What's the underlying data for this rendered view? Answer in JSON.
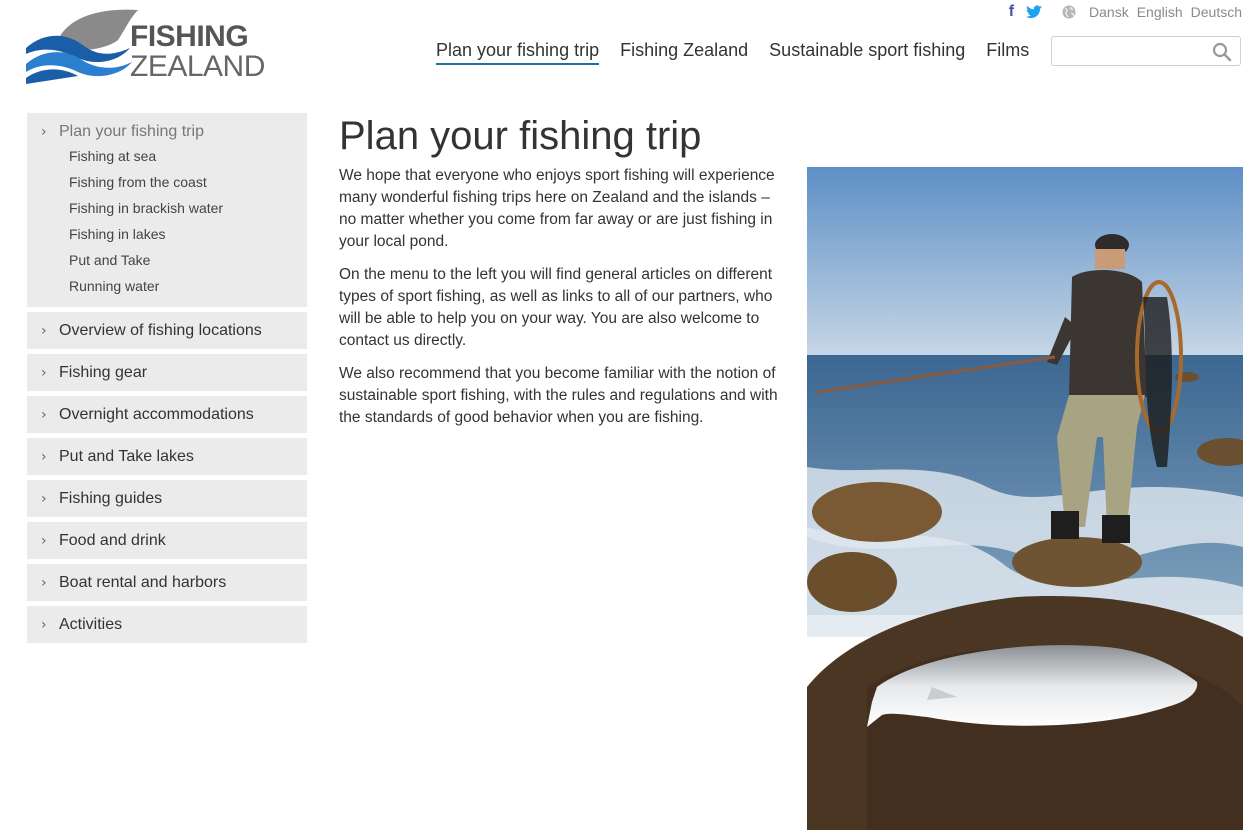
{
  "logo": {
    "line1": "FISHING",
    "line2": "ZEALAND"
  },
  "utility": {
    "facebook": "f",
    "languages": [
      "Dansk",
      "English",
      "Deutsch"
    ]
  },
  "nav": {
    "items": [
      {
        "label": "Plan your fishing trip",
        "active": true
      },
      {
        "label": "Fishing Zealand"
      },
      {
        "label": "Sustainable sport fishing"
      },
      {
        "label": "Films"
      }
    ]
  },
  "search": {
    "value": "",
    "placeholder": ""
  },
  "sidebar": {
    "open_section": {
      "label": "Plan your fishing trip",
      "children": [
        "Fishing at sea",
        "Fishing from the coast",
        "Fishing in brackish water",
        "Fishing in lakes",
        "Put and Take",
        "Running water"
      ]
    },
    "items": [
      "Overview of fishing locations",
      "Fishing gear",
      "Overnight accommodations",
      "Put and Take lakes",
      "Fishing guides",
      "Food and drink",
      "Boat rental and harbors",
      "Activities"
    ]
  },
  "content": {
    "title": "Plan your fishing trip",
    "paragraphs": [
      "We hope that everyone who enjoys sport fishing will experience many wonderful fishing trips here on Zealand and the islands – no matter whether you come from far away or are just fishing in your local pond.",
      "On the menu to the left you will find general articles on different types of sport fishing, as well as links to all of our partners, who will be able to help you on your way. You are also welcome to contact us directly.",
      "We also recommend that you become familiar with the notion of sustainable sport fishing, with the rules and regulations and with the standards of good behavior when you are fishing."
    ]
  },
  "colors": {
    "accent": "#1d6fa5",
    "sidebar_bg": "#ebebeb",
    "logo_blue": "#1a5ea8"
  }
}
